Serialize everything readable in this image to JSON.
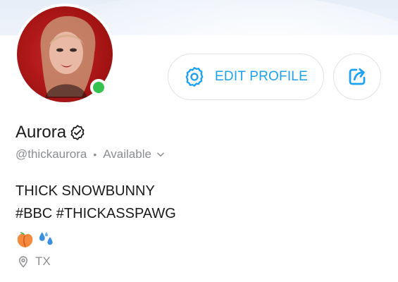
{
  "profile": {
    "name": "Aurora",
    "handle": "@thickaurora",
    "status": "Available",
    "bio_line1": "THICK SNOWBUNNY",
    "bio_line2": "#BBC #THICKASSPAWG",
    "location": "TX",
    "online": true
  },
  "actions": {
    "edit_profile_label": "EDIT PROFILE"
  },
  "icons": {
    "settings": "gear-icon",
    "share": "share-icon",
    "verified": "verified-badge-icon",
    "status_menu": "chevron-down-icon",
    "location": "location-pin-icon",
    "emoji_1": "peach-emoji",
    "emoji_2": "water-droplets-emoji"
  },
  "colors": {
    "accent": "#1da1f2",
    "online": "#33c24d",
    "muted_text": "#8a8d91",
    "avatar_bg": "#c92a2a"
  }
}
